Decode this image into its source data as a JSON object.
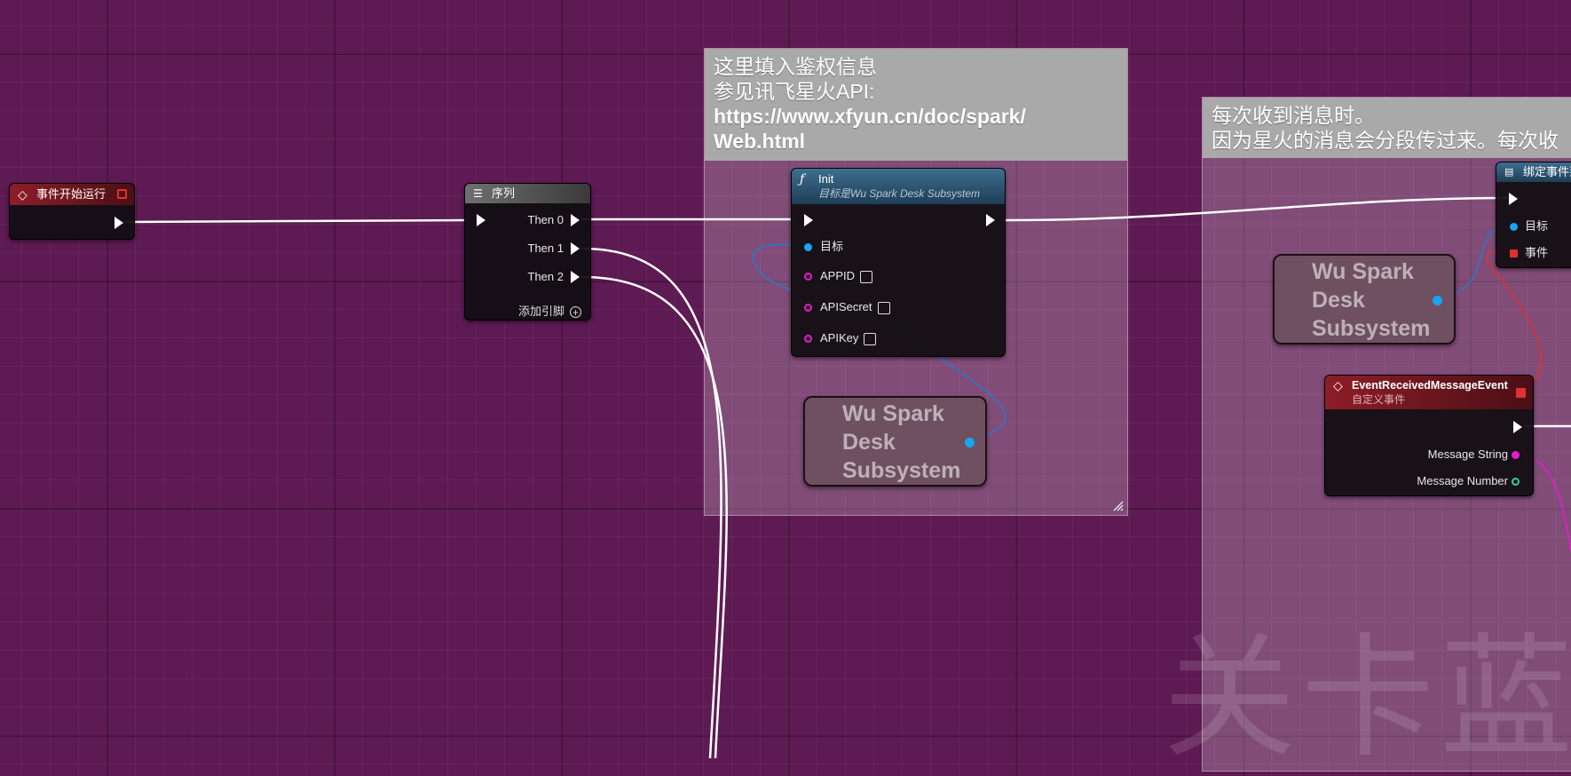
{
  "canvas": {
    "background": "#5e1a52",
    "watermark": "关卡蓝图"
  },
  "comments": [
    {
      "line1": "这里填入鉴权信息",
      "line2": "参见讯飞星火API:",
      "line3": "https://www.xfyun.cn/doc/spark/",
      "line4": "Web.html"
    },
    {
      "line1": "每次收到消息时。",
      "line2": "因为星火的消息会分段传过来。每次收"
    }
  ],
  "nodes": {
    "begin_play": {
      "title": "事件开始运行",
      "icon": "event-diamond-icon"
    },
    "sequence": {
      "title": "序列",
      "icon": "sequence-icon",
      "pins": [
        "Then 0",
        "Then 1",
        "Then 2"
      ],
      "add_pin": "添加引脚"
    },
    "init": {
      "title": "Init",
      "subtitle": "目标是Wu Spark Desk Subsystem",
      "icon": "function-icon",
      "pins": {
        "target": "目标",
        "appid": "APPID",
        "apisecret": "APISecret",
        "apikey": "APIKey"
      }
    },
    "subsystem_var_1": {
      "line1": "Wu Spark",
      "line2": "Desk",
      "line3": "Subsystem"
    },
    "subsystem_var_2": {
      "line1": "Wu Spark",
      "line2": "Desk",
      "line3": "Subsystem"
    },
    "bind_event": {
      "title": "绑定事件到",
      "pins": {
        "target": "目标",
        "event": "事件"
      }
    },
    "custom_event": {
      "title": "EventReceivedMessageEvent",
      "subtitle": "自定义事件",
      "pins": {
        "message_string": "Message String",
        "message_number": "Message Number"
      }
    }
  },
  "colors": {
    "exec_wire": "#ffffff",
    "object_pin": "#19a4f0",
    "string_pin": "#e81bd2",
    "int_pin": "#2ed2a0",
    "delegate_pin": "#e03030"
  }
}
